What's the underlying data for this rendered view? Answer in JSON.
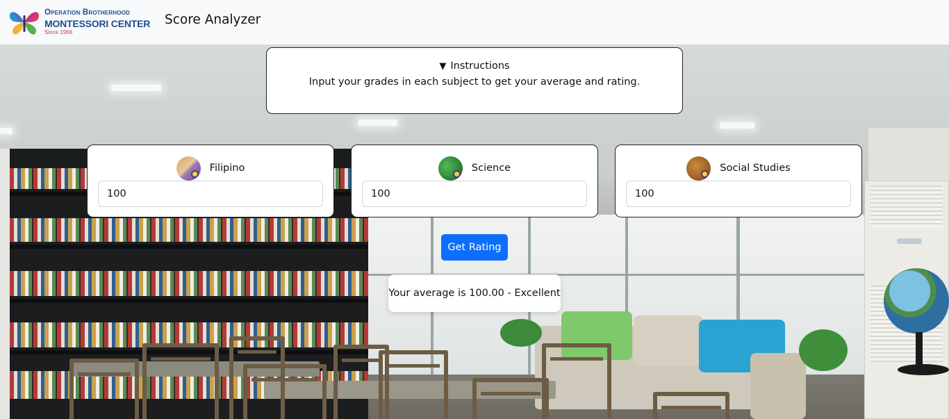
{
  "navbar": {
    "logo": {
      "line1": "Operation Brotherhood",
      "line2": "MONTESSORI CENTER",
      "line3": "Since 1966"
    },
    "brand": "Score Analyzer"
  },
  "instructions": {
    "summary": "Instructions",
    "body": "Input your grades in each subject to get your average and rating."
  },
  "subjects": [
    {
      "label": "Filipino",
      "value": "100",
      "icon": "filipino-subject-icon"
    },
    {
      "label": "Science",
      "value": "100",
      "icon": "science-subject-icon"
    },
    {
      "label": "Social Studies",
      "value": "100",
      "icon": "social-studies-subject-icon"
    }
  ],
  "actions": {
    "get_rating": "Get Rating"
  },
  "result": {
    "text": "Your average is 100.00 - Excellent"
  },
  "colors": {
    "primary": "#0d6efd",
    "navbar_bg": "#f8f9fa",
    "logo_blue": "#1f4d8f",
    "logo_pink": "#d0356a"
  }
}
